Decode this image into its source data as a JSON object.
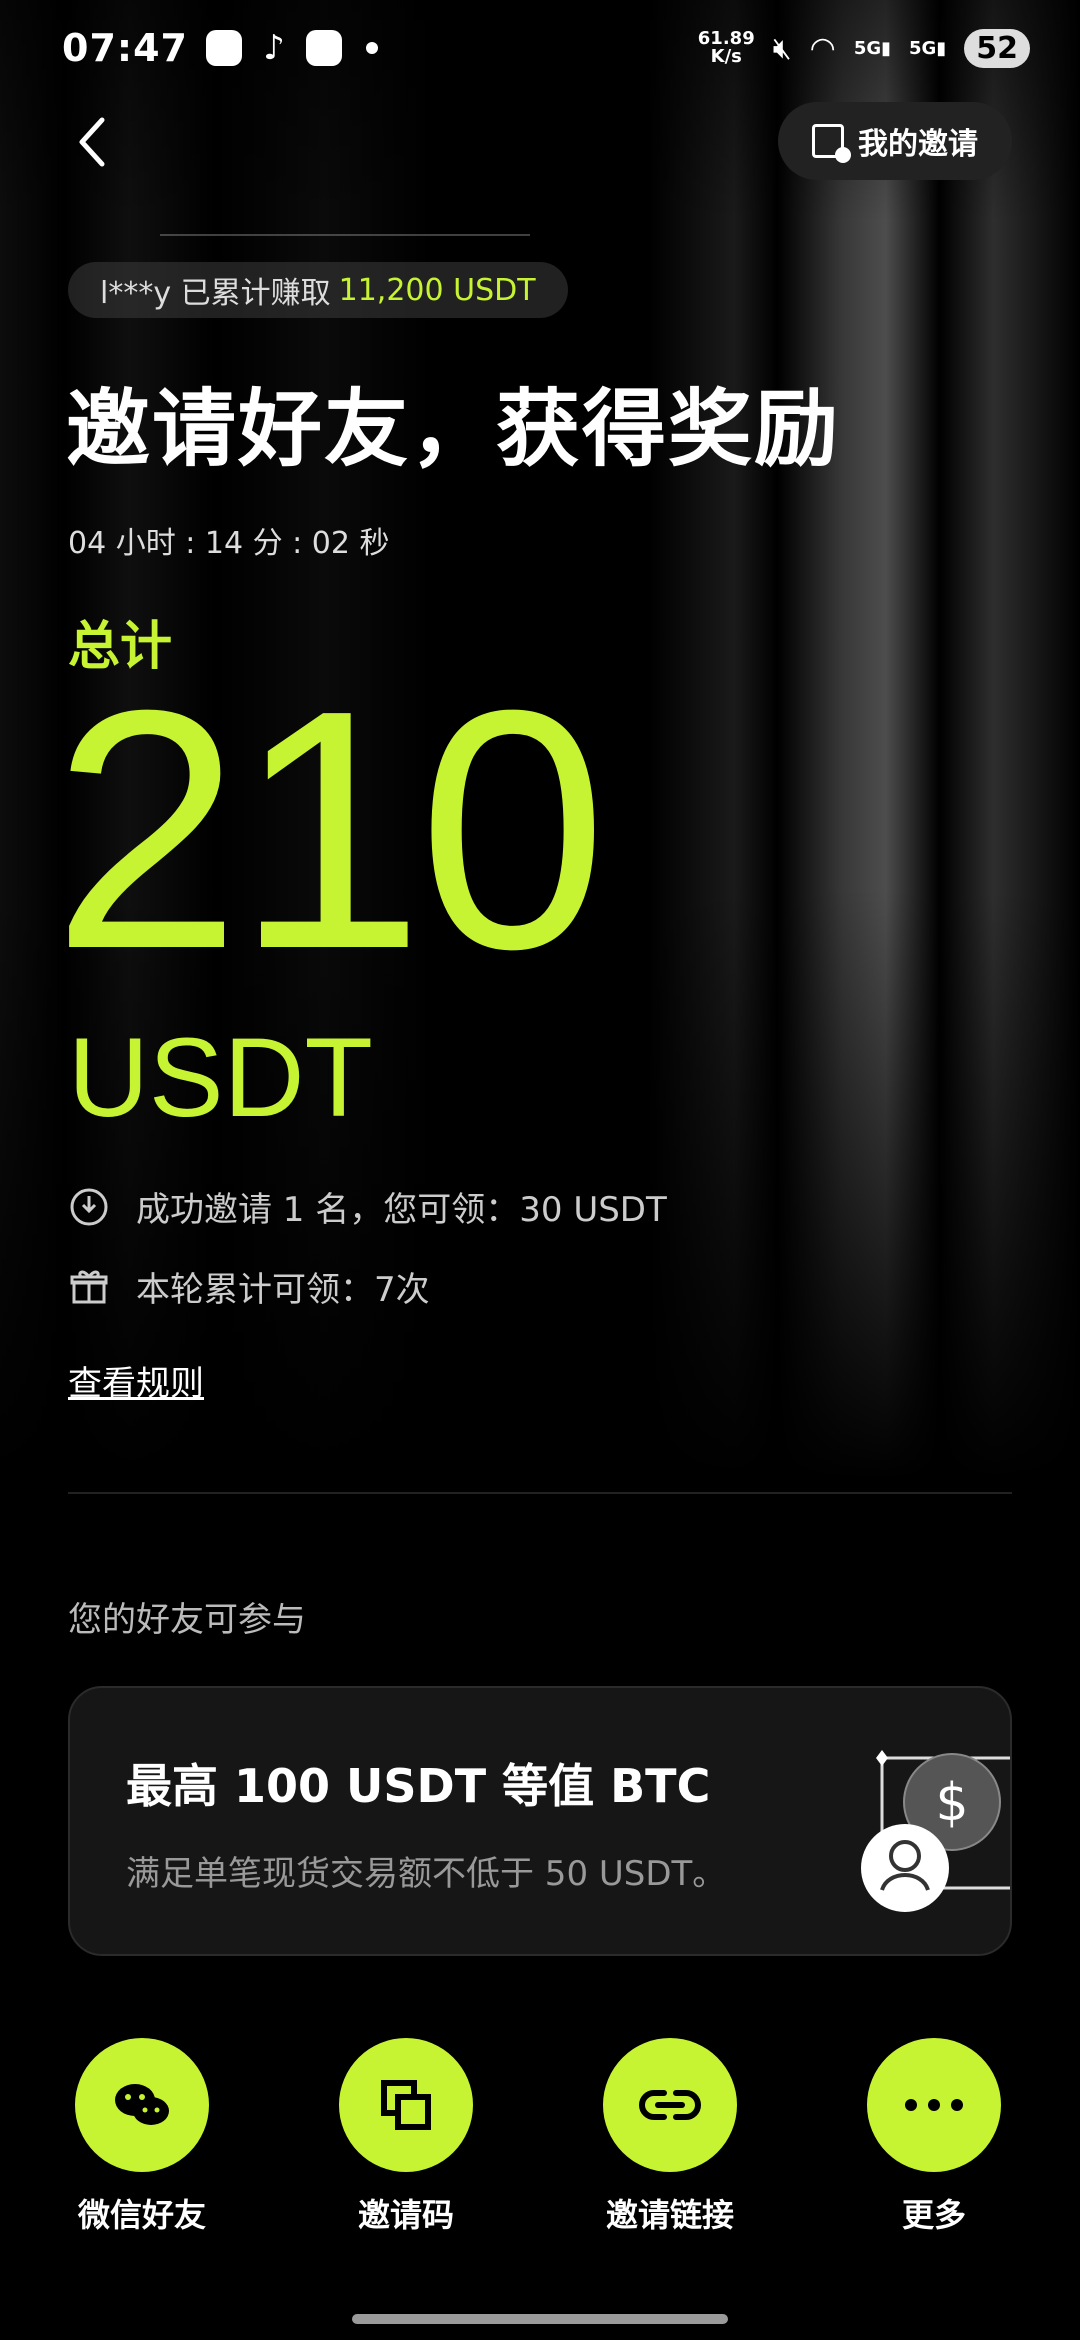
{
  "status_bar": {
    "time": "07:47",
    "net_speed_value": "61.89",
    "net_speed_unit": "K/s",
    "signal1_label": "5G",
    "signal2_label": "5G",
    "battery": "52"
  },
  "header": {
    "back_icon": "chevron-left-icon",
    "my_invites_label": "我的邀请"
  },
  "ticker": {
    "user": "l***y 已累计赚取",
    "amount": "11,200 USDT"
  },
  "hero": {
    "headline": "邀请好友，获得奖励",
    "countdown": "04 小时 : 14 分 : 02 秒",
    "total_label": "总计",
    "total_value": "210",
    "total_unit": "USDT"
  },
  "info": {
    "line1": "成功邀请 1 名，您可领：30 USDT",
    "line2": "本轮累计可领：7次",
    "rules_link": "查看规则"
  },
  "friends": {
    "section_title": "您的好友可参与",
    "card_title": "最高 100 USDT 等值 BTC",
    "card_desc": "满足单笔现货交易额不低于 50 USDT。",
    "card_currency_symbol": "$"
  },
  "actions": [
    {
      "label": "微信好友",
      "icon": "wechat-icon"
    },
    {
      "label": "邀请码",
      "icon": "copy-icon"
    },
    {
      "label": "邀请链接",
      "icon": "link-icon"
    },
    {
      "label": "更多",
      "icon": "more-icon"
    }
  ],
  "colors": {
    "accent": "#c6f432",
    "background": "#000000",
    "card": "#161616"
  }
}
